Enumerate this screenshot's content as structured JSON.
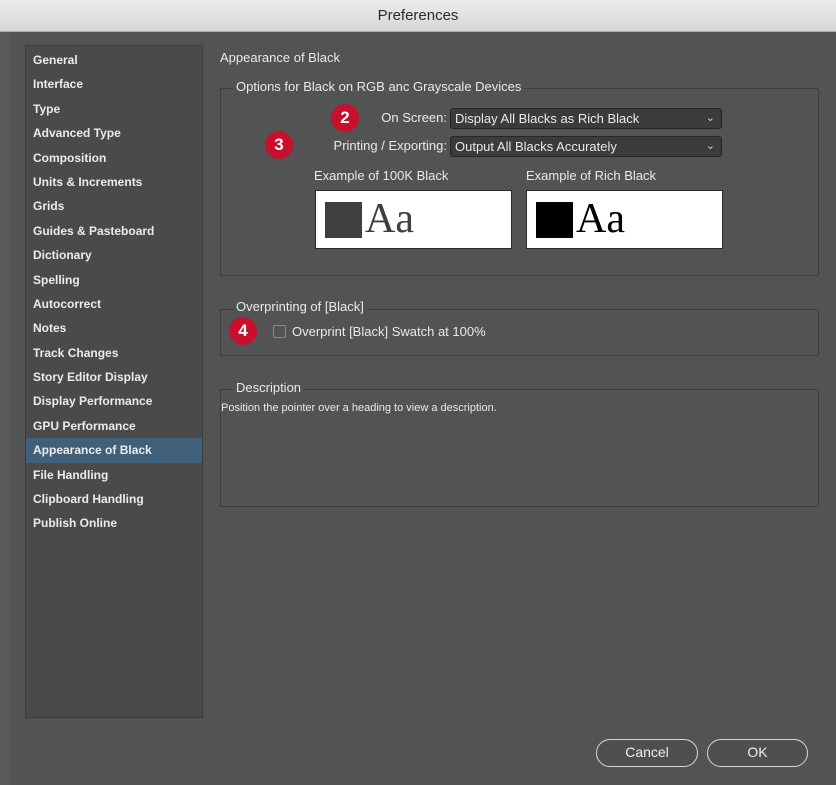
{
  "window": {
    "title": "Preferences"
  },
  "sidebar": {
    "items": [
      {
        "label": "General"
      },
      {
        "label": "Interface"
      },
      {
        "label": "Type"
      },
      {
        "label": "Advanced Type"
      },
      {
        "label": "Composition"
      },
      {
        "label": "Units & Increments"
      },
      {
        "label": "Grids"
      },
      {
        "label": "Guides & Pasteboard"
      },
      {
        "label": "Dictionary"
      },
      {
        "label": "Spelling"
      },
      {
        "label": "Autocorrect"
      },
      {
        "label": "Notes"
      },
      {
        "label": "Track Changes"
      },
      {
        "label": "Story Editor Display"
      },
      {
        "label": "Display Performance"
      },
      {
        "label": "GPU Performance"
      },
      {
        "label": "Appearance of Black"
      },
      {
        "label": "File Handling"
      },
      {
        "label": "Clipboard Handling"
      },
      {
        "label": "Publish Online"
      }
    ],
    "selected": "Appearance of Black"
  },
  "main": {
    "section_title": "Appearance of Black",
    "options_group": {
      "legend": "Options for Black on RGB anc Grayscale Devices",
      "on_screen_label": "On Screen:",
      "on_screen_value": "Display All Blacks as Rich Black",
      "printing_label": "Printing / Exporting:",
      "printing_value": "Output All Blacks Accurately",
      "example_100k_label": "Example of 100K Black",
      "example_rich_label": "Example of Rich Black",
      "example_text": "Aa",
      "swatch_100k_color": "#3f3f3f",
      "swatch_rich_color": "#000000"
    },
    "overprint_group": {
      "legend": "Overprinting of [Black]",
      "checkbox_label": "Overprint [Black] Swatch at 100%",
      "checked": false
    },
    "description_group": {
      "legend": "Description",
      "text": "Position the pointer over a heading to view a description."
    }
  },
  "badges": {
    "on_screen": "2",
    "printing": "3",
    "overprint": "4"
  },
  "buttons": {
    "cancel": "Cancel",
    "ok": "OK"
  },
  "colors": {
    "badge": "#c8102e",
    "selection": "#40607a",
    "checkbox_border": "#4c98e0"
  }
}
